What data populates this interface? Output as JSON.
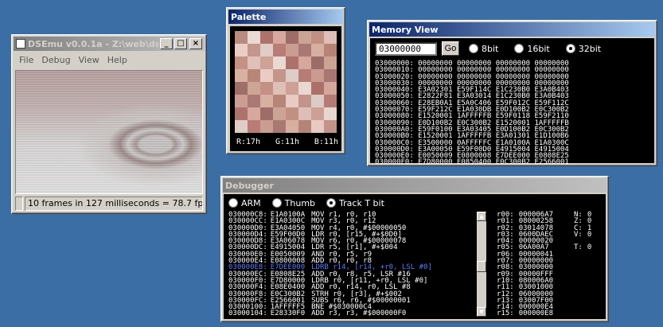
{
  "dsemu": {
    "title": "DSEmu v0.0.1a - Z:\\web\\ds...",
    "menu": [
      "File",
      "Debug",
      "View",
      "Help"
    ],
    "status": "10 frames in 127 milliseconds = 78.7 fps."
  },
  "palette": {
    "title": "Palette",
    "r": "R:17h",
    "g": "G:11h",
    "b": "B:11h"
  },
  "memory": {
    "title": "Memory View",
    "address": "03000000",
    "go": "Go",
    "radios": [
      "8bit",
      "16bit",
      "32bit"
    ],
    "selected": "32bit",
    "rows": [
      "03000000: 00000000 00000000 00000000 00000000",
      "03000010: 00000000 00000000 00000000 00000000",
      "03000020: 00000000 00000000 00000000 00000000",
      "03000030: 00000000 00000000 00000000 00000000",
      "03000040: E3A02301 E59F114C E1C230B0 E3A0B403",
      "03000050: E2822F81 E3A03014 E1C230B0 E3A0B403",
      "03000060: E28EB0A1 E5A0C406 E59F012C E59F112C",
      "03000070: E59F212C E1A030DB E0D100B2 E0C300B2",
      "03000080: E1520001 1AFFFFFB E59F0118 E59F2110",
      "03000090: E0D100B2 E0C300B2 E1520001 1AFFFFFB",
      "030000A0: E59F0100 E3A03405 E0D100B2 E0C300B2",
      "030000B0: E1520001 1AFFFFFB E3A01301 E1D100B6",
      "030000C0: E3500000 0AFFFFFC E1A0100A E1A0300C",
      "030000D0: E3A00050 E59F00D0 E4915004 E4915004",
      "030000E0: E0050009 E0800008 E7DEE000 E0808E25",
      "030000F0: E7D80000 E0850400 E0C300B2 E2566001"
    ]
  },
  "debugger": {
    "title": "Debugger",
    "radios": [
      "ARM",
      "Thumb",
      "Track T bit"
    ],
    "selected": "Track T bit",
    "lines": [
      {
        "addr": "030000C8:",
        "op": "E1A0100A",
        "asm": "MOV r1, r0, r10"
      },
      {
        "addr": "030000CC:",
        "op": "E1A0300C",
        "asm": "MOV r3, r0, r12"
      },
      {
        "addr": "030000D0:",
        "op": "E3A04050",
        "asm": "MOV r4, r0, #$00000050"
      },
      {
        "addr": "030000D4:",
        "op": "E59F00D0",
        "asm": "LDR r0, [r15, #+$0D0]"
      },
      {
        "addr": "030000D8:",
        "op": "E3A06078",
        "asm": "MOV r6, r0, #$00000078"
      },
      {
        "addr": "030000DC:",
        "op": "E4915004",
        "asm": "LDR r5, [r1], #+$004"
      },
      {
        "addr": "030000E0:",
        "op": "E0050009",
        "asm": "AND r0, r5, r9"
      },
      {
        "addr": "030000E4:",
        "op": "E0800008",
        "asm": "ADD r0, r0, r8"
      },
      {
        "addr": "030000E8:",
        "op": "E7DEE000",
        "asm": "LDRB r14, [r14, +r0, LSL #0]"
      },
      {
        "addr": "030000EC:",
        "op": "E0808E25",
        "asm": "ADD r0, r8, r5, LSR #16"
      },
      {
        "addr": "030000F0:",
        "op": "E7D80000",
        "asm": "LDRB r0, [r11, +r0, LSL #0]"
      },
      {
        "addr": "030000F4:",
        "op": "E08E0400",
        "asm": "ADD r0, r14, r0, LSL #8"
      },
      {
        "addr": "030000F8:",
        "op": "E0C300B2",
        "asm": "STRH r0, [r3], #+$002"
      },
      {
        "addr": "030000FC:",
        "op": "E2566001",
        "asm": "SUBS r6, r6, #$00000001"
      },
      {
        "addr": "03000100:",
        "op": "1AFFFFF5",
        "asm": "BNE #$030000C4"
      },
      {
        "addr": "03000104:",
        "op": "E28330F0",
        "asm": "ADD r3, r3, #$000000F0"
      }
    ],
    "highlight_index": 8,
    "highlight_color": "#5c7cff",
    "registers": [
      {
        "name": "r00:",
        "val": "000006A7"
      },
      {
        "name": "r01:",
        "val": "08000258"
      },
      {
        "name": "r02:",
        "val": "03014078"
      },
      {
        "name": "r03:",
        "val": "0600DAEC"
      },
      {
        "name": "r04:",
        "val": "00000020"
      },
      {
        "name": "r05:",
        "val": "06A00A7"
      },
      {
        "name": "r06:",
        "val": "00000041"
      },
      {
        "name": "r07:",
        "val": "00000000"
      },
      {
        "name": "r08:",
        "val": "03000000"
      },
      {
        "name": "r09:",
        "val": "00000FFF"
      },
      {
        "name": "r10:",
        "val": "080006A0"
      },
      {
        "name": "r11:",
        "val": "03001000"
      },
      {
        "name": "r12:",
        "val": "06000000"
      },
      {
        "name": "r13:",
        "val": "03007F00"
      },
      {
        "name": "r14:",
        "val": "000000E4"
      },
      {
        "name": "r15:",
        "val": "000000E8"
      }
    ],
    "flags": [
      {
        "name": "N:",
        "val": "0"
      },
      {
        "name": "Z:",
        "val": "0"
      },
      {
        "name": "C:",
        "val": "1"
      },
      {
        "name": "V:",
        "val": "0"
      },
      {
        "name": "",
        "val": ""
      },
      {
        "name": "T:",
        "val": "0"
      }
    ]
  }
}
